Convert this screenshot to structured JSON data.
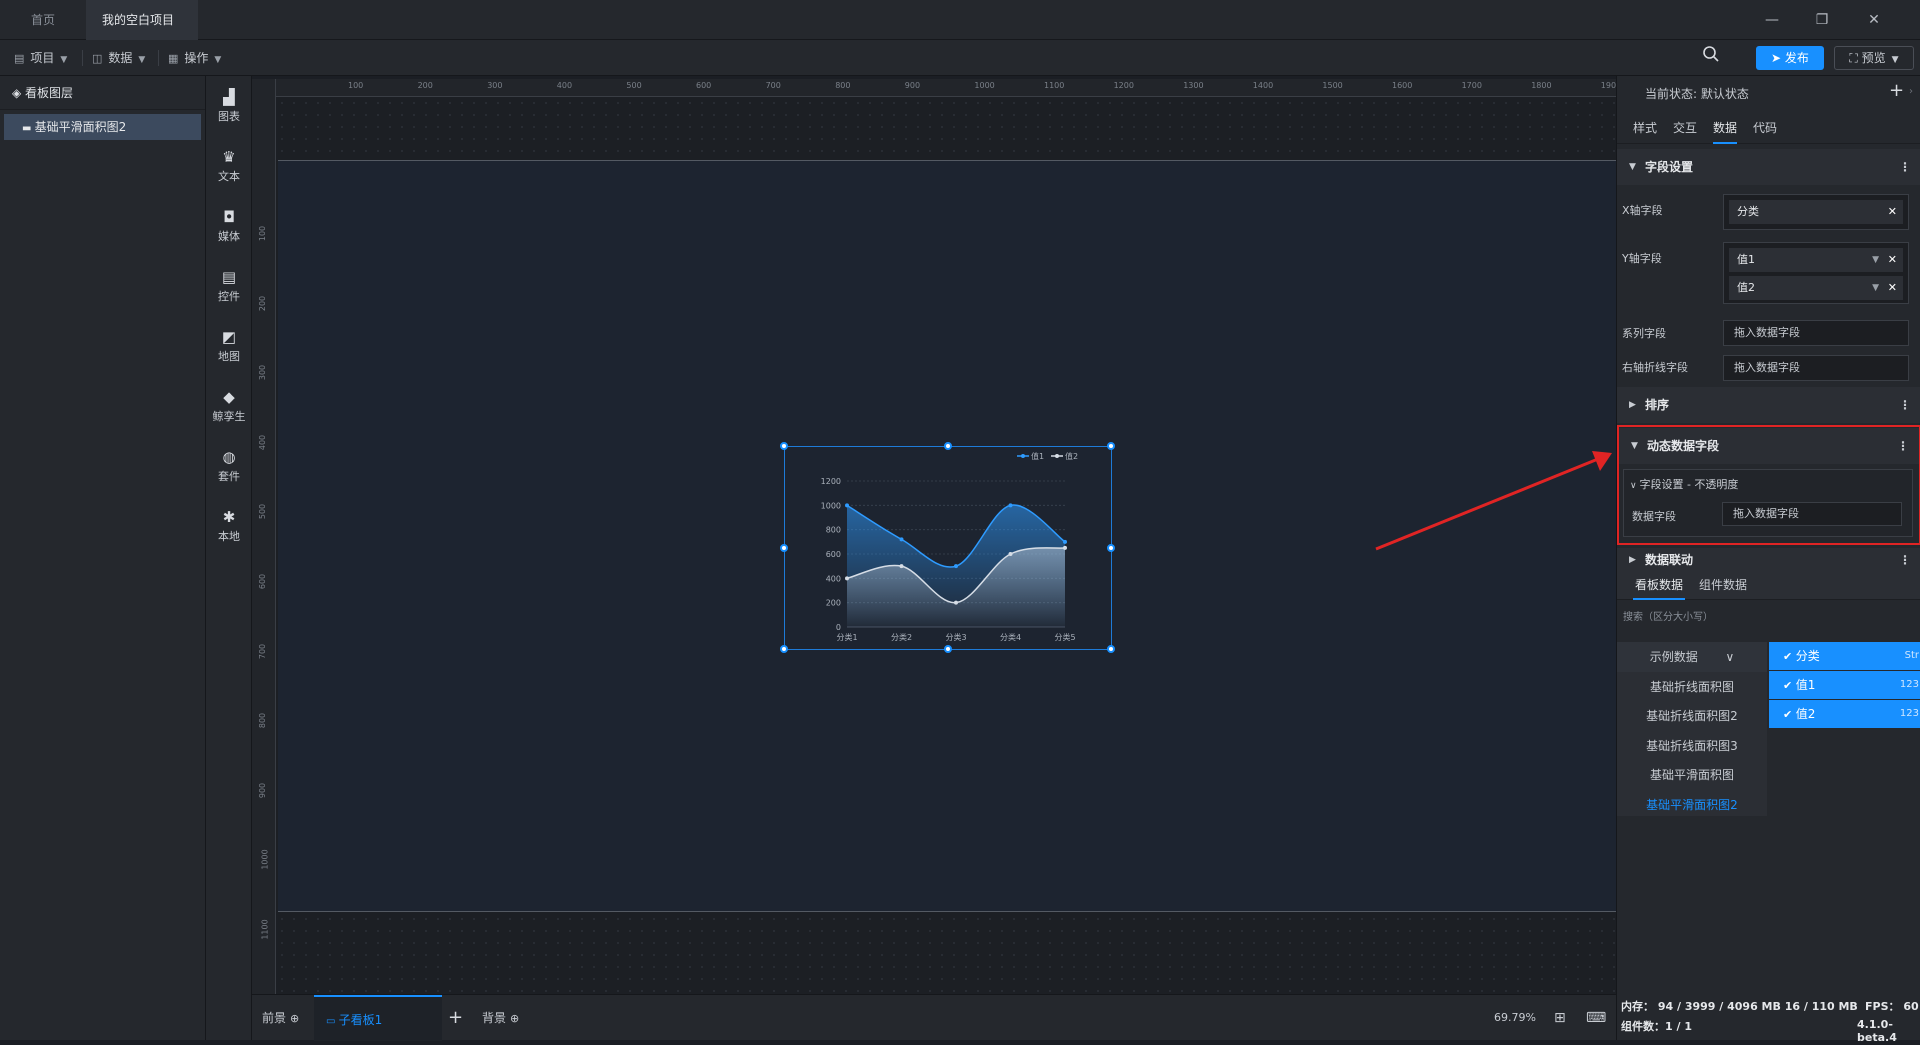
{
  "titlebar": {
    "tab_home": "首页",
    "tab_project": "我的空白项目",
    "min": "—",
    "restore": "❐",
    "close": "✕"
  },
  "toolbar": {
    "menu_project": "项目",
    "menu_data": "数据",
    "menu_operate": "操作",
    "publish": "发布",
    "preview": "预览",
    "publish_color": "#1890ff"
  },
  "layers": {
    "title": "看板图层",
    "items": [
      "基础平滑面积图2"
    ]
  },
  "components": {
    "items": [
      "图表",
      "文本",
      "媒体",
      "控件",
      "地图",
      "鲸孪生",
      "套件",
      "本地"
    ],
    "icons": [
      "chart-icon",
      "text-icon",
      "media-icon",
      "control-icon",
      "map-icon",
      "twin-icon",
      "kit-icon",
      "local-icon"
    ]
  },
  "ruler": {
    "top": [
      "100",
      "200",
      "300",
      "400",
      "500",
      "600",
      "700",
      "800",
      "900",
      "1000",
      "1100",
      "1200",
      "1300",
      "1400",
      "1500",
      "1600",
      "1700",
      "1800",
      "1900"
    ],
    "left": [
      "100",
      "200",
      "300",
      "400",
      "500",
      "600",
      "700",
      "800",
      "900",
      "1000",
      "1100"
    ]
  },
  "chart_data": {
    "type": "area",
    "categories": [
      "分类1",
      "分类2",
      "分类3",
      "分类4",
      "分类5"
    ],
    "series": [
      {
        "name": "值1",
        "values": [
          1000,
          720,
          500,
          1000,
          700
        ],
        "color": "#2e9bff"
      },
      {
        "name": "值2",
        "values": [
          400,
          500,
          200,
          600,
          650
        ],
        "color": "#d6dde6"
      }
    ],
    "yticks": [
      "0",
      "200",
      "400",
      "600",
      "800",
      "1000",
      "1200"
    ],
    "ylim": [
      0,
      1200
    ],
    "grid": true,
    "legend": "top-right",
    "smooth": true
  },
  "bottom": {
    "front": "前景",
    "subboard": "子看板1",
    "add": "+",
    "background": "背景",
    "zoom": "69.79%"
  },
  "panel": {
    "state_label": "当前状态:",
    "state_value": "默认状态",
    "tabs": [
      "样式",
      "交互",
      "数据",
      "代码"
    ],
    "active_tab": "数据",
    "sections": {
      "field_settings": "字段设置",
      "sort": "排序",
      "dynamic": "动态数据字段",
      "linkage": "数据联动"
    },
    "x_label": "X轴字段",
    "x_value": "分类",
    "y_label": "Y轴字段",
    "y_values": [
      "值1",
      "值2"
    ],
    "series_label": "系列字段",
    "series_placeholder": "拖入数据字段",
    "right_label": "右轴折线字段",
    "right_placeholder": "拖入数据字段",
    "dynamic_sub": "字段设置 - 不透明度",
    "dynamic_field_label": "数据字段",
    "dynamic_field_placeholder": "拖入数据字段",
    "link_tabs": [
      "看板数据",
      "组件数据"
    ],
    "search_placeholder": "搜索（区分大小写）",
    "data_sources": [
      "示例数据",
      "基础折线面积图",
      "基础折线面积图2",
      "基础折线面积图3",
      "基础平滑面积图",
      "基础平滑面积图2"
    ],
    "active_source": "基础平滑面积图2",
    "fields": [
      {
        "name": "分类",
        "type": "Str"
      },
      {
        "name": "值1",
        "type": "123"
      },
      {
        "name": "值2",
        "type": "123"
      }
    ],
    "highlight_color": "#e02424"
  },
  "status": {
    "memory": "内存：  94 / 3999 / 4096 MB  16 / 110 MB",
    "count": "组件数：1 / 1",
    "fps": "FPS：  60",
    "version": "4.1.0-beta.4"
  }
}
